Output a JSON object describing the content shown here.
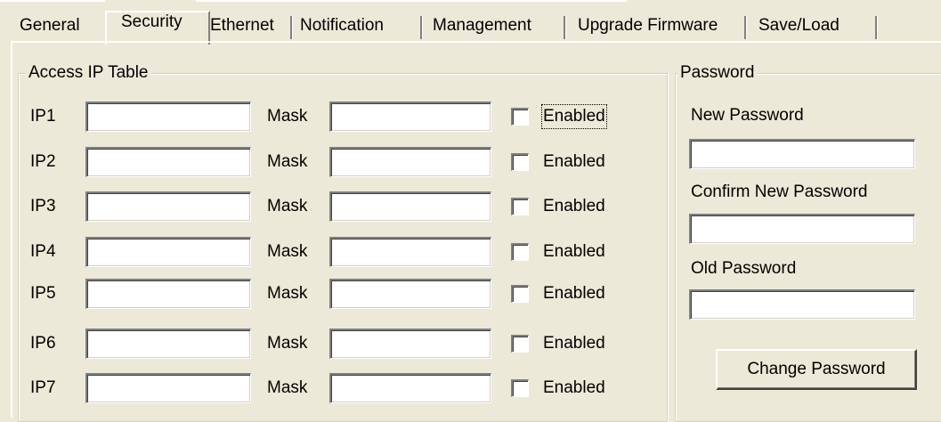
{
  "tabs": [
    {
      "label": "General",
      "active": false
    },
    {
      "label": "Security",
      "active": true
    },
    {
      "label": "Ethernet",
      "active": false
    },
    {
      "label": "Notification",
      "active": false
    },
    {
      "label": "Management",
      "active": false
    },
    {
      "label": "Upgrade Firmware",
      "active": false
    },
    {
      "label": "Save/Load",
      "active": false
    }
  ],
  "access_ip_table": {
    "title": "Access IP Table",
    "mask_label": "Mask",
    "enabled_label": "Enabled",
    "rows": [
      {
        "ip_label": "IP1",
        "ip_value": "",
        "mask_value": "",
        "enabled": false
      },
      {
        "ip_label": "IP2",
        "ip_value": "",
        "mask_value": "",
        "enabled": false
      },
      {
        "ip_label": "IP3",
        "ip_value": "",
        "mask_value": "",
        "enabled": false
      },
      {
        "ip_label": "IP4",
        "ip_value": "",
        "mask_value": "",
        "enabled": false
      },
      {
        "ip_label": "IP5",
        "ip_value": "",
        "mask_value": "",
        "enabled": false
      },
      {
        "ip_label": "IP6",
        "ip_value": "",
        "mask_value": "",
        "enabled": false
      },
      {
        "ip_label": "IP7",
        "ip_value": "",
        "mask_value": "",
        "enabled": false
      }
    ]
  },
  "password": {
    "title": "Password",
    "new_label": "New Password",
    "new_value": "",
    "confirm_label": "Confirm New Password",
    "confirm_value": "",
    "old_label": "Old Password",
    "old_value": "",
    "change_button": "Change Password"
  }
}
